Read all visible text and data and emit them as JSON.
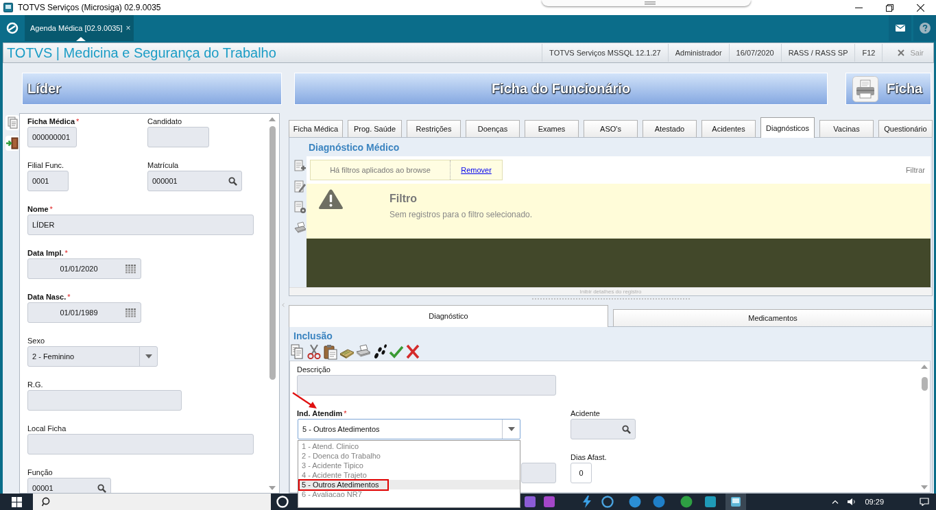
{
  "window": {
    "title": "TOTVS Serviços (Microsiga) 02.9.0035"
  },
  "app_bar": {
    "tabs": [
      {
        "label": "Agenda Médica [02.9.0035]",
        "close": "×",
        "selected": true
      }
    ]
  },
  "header": {
    "title": "TOTVS | Medicina e Segurança do Trabalho",
    "info": [
      "TOTVS Serviços MSSQL 12.1.27",
      "Administrador",
      "16/07/2020",
      "RASS / RASS SP",
      "F12"
    ],
    "exit": "Sair"
  },
  "banners": {
    "employee_name": "Líder",
    "title": "Ficha do Funcionário",
    "print_button": "Ficha"
  },
  "employee_form": {
    "rows": [
      {
        "fields": [
          {
            "label": "Ficha Médica",
            "required_mark": "*",
            "kind": "text",
            "value": "000000001",
            "disabled": true
          },
          {
            "label": "Candidato",
            "kind": "text",
            "disabled": true
          }
        ]
      },
      {
        "fields": [
          {
            "label": "Filial Func.",
            "kind": "text",
            "value": "0001",
            "disabled": true
          },
          {
            "label": "Matrícula",
            "kind": "lookup",
            "value": "000001",
            "disabled": true
          }
        ]
      },
      {
        "fields": [
          {
            "label": "Nome",
            "required_mark": "*",
            "kind": "text",
            "value": "LÍDER",
            "disabled": true
          }
        ]
      },
      {
        "fields": [
          {
            "label": "Data Impl.",
            "required_mark": "*",
            "kind": "date",
            "value": "01/01/2020",
            "disabled": true
          }
        ]
      },
      {
        "fields": [
          {
            "label": "Data Nasc.",
            "required_mark": "*",
            "kind": "date",
            "value": "01/01/1989",
            "disabled": true
          }
        ]
      },
      {
        "fields": [
          {
            "label": "Sexo",
            "kind": "select",
            "value": "2 - Feminino",
            "expanded": false,
            "disabled": true
          }
        ]
      },
      {
        "fields": [
          {
            "label": "R.G.",
            "kind": "text",
            "disabled": true
          }
        ]
      },
      {
        "fields": [
          {
            "label": "Local Ficha",
            "kind": "text",
            "disabled": true
          }
        ]
      },
      {
        "fields": [
          {
            "label": "Função",
            "kind": "lookup",
            "value": "00001",
            "disabled": true
          }
        ]
      }
    ]
  },
  "record_tabs": [
    {
      "label": "Ficha Médica",
      "selected": false
    },
    {
      "label": "Prog. Saúde",
      "selected": false
    },
    {
      "label": "Restrições",
      "selected": false
    },
    {
      "label": "Doenças",
      "selected": false
    },
    {
      "label": "Exames",
      "selected": false
    },
    {
      "label": "ASO's",
      "selected": false
    },
    {
      "label": "Atestado",
      "selected": false
    },
    {
      "label": "Acidentes",
      "selected": false
    },
    {
      "label": "Diagnósticos",
      "selected": true
    },
    {
      "label": "Vacinas",
      "selected": false
    },
    {
      "label": "Questionário",
      "selected": false
    }
  ],
  "diagnosis_panel": {
    "title": "Diagnóstico Médico",
    "filter_notice": "Há filtros aplicados ao browse",
    "remove_link": "Remover",
    "filter_button": "Filtrar",
    "message": {
      "title": "Filtro",
      "text": "Sem registros para o filtro selecionado."
    },
    "details_toggle": "Inibir detalhes do registro"
  },
  "detail_tabs": [
    {
      "label": "Diagnóstico",
      "selected": true
    },
    {
      "label": "Medicamentos",
      "selected": false
    }
  ],
  "inclusion": {
    "title": "Inclusão",
    "fields": [
      {
        "label": "Descrição",
        "kind": "text",
        "disabled": true
      },
      {
        "label": "Ind. Atendim",
        "required_mark": "*",
        "kind": "select",
        "value": "5 - Outros Atedimentos",
        "disabled": false,
        "expanded": true,
        "annotated": true,
        "options": [
          {
            "label": "1 - Atend. Clinico",
            "selected": false,
            "highlighted": false
          },
          {
            "label": "2 - Doenca do Trabalho",
            "selected": false,
            "highlighted": false
          },
          {
            "label": "3 - Acidente Tipico",
            "selected": false,
            "highlighted": false
          },
          {
            "label": "4 - Acidente Trajeto",
            "selected": false,
            "highlighted": false
          },
          {
            "label": "5 - Outros Atedimentos",
            "selected": true,
            "highlighted": true
          },
          {
            "label": "6 - Avaliacao NR7",
            "selected": false,
            "highlighted": false
          }
        ]
      },
      {
        "label": "Acidente",
        "kind": "lookup",
        "disabled": true
      },
      {
        "kind": "text",
        "disabled": true
      },
      {
        "label": "Dias Afast.",
        "kind": "number",
        "value": "0",
        "disabled": false
      }
    ]
  },
  "taskbar": {
    "clock": "09:29"
  }
}
